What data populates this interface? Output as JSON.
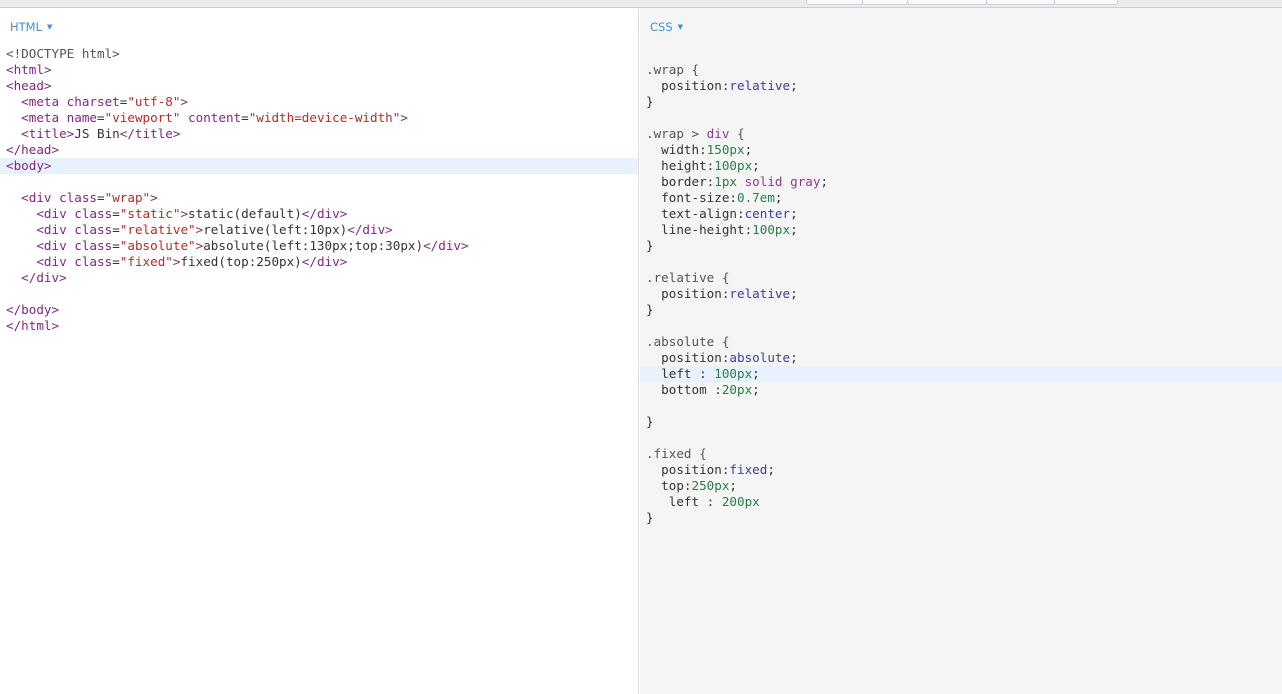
{
  "html_panel": {
    "label": "HTML",
    "lines": [
      [
        [
          "doc",
          "<!DOCTYPE html>"
        ]
      ],
      [
        [
          "tag",
          "<html>"
        ]
      ],
      [
        [
          "tag",
          "<head>"
        ]
      ],
      [
        [
          "txt",
          "  "
        ],
        [
          "tag",
          "<meta "
        ],
        [
          "attr",
          "charset"
        ],
        [
          "txt",
          "="
        ],
        [
          "str",
          "\"utf-8\""
        ],
        [
          "tag",
          ">"
        ]
      ],
      [
        [
          "txt",
          "  "
        ],
        [
          "tag",
          "<meta "
        ],
        [
          "attr",
          "name"
        ],
        [
          "txt",
          "="
        ],
        [
          "str",
          "\"viewport\""
        ],
        [
          "txt",
          " "
        ],
        [
          "attr",
          "content"
        ],
        [
          "txt",
          "="
        ],
        [
          "str",
          "\"width=device-width\""
        ],
        [
          "tag",
          ">"
        ]
      ],
      [
        [
          "txt",
          "  "
        ],
        [
          "tag",
          "<title>"
        ],
        [
          "txt",
          "JS Bin"
        ],
        [
          "tag",
          "</title>"
        ]
      ],
      [
        [
          "tag",
          "</head>"
        ]
      ],
      [
        [
          "tag",
          "<body>"
        ]
      ],
      [
        [
          "txt",
          ""
        ]
      ],
      [
        [
          "txt",
          "  "
        ],
        [
          "tag",
          "<div "
        ],
        [
          "attr",
          "class"
        ],
        [
          "txt",
          "="
        ],
        [
          "str",
          "\"wrap\""
        ],
        [
          "tag",
          ">"
        ]
      ],
      [
        [
          "txt",
          "    "
        ],
        [
          "tag",
          "<div "
        ],
        [
          "attr",
          "class"
        ],
        [
          "txt",
          "="
        ],
        [
          "str",
          "\"static\""
        ],
        [
          "tag",
          ">"
        ],
        [
          "txt",
          "static(default)"
        ],
        [
          "tag",
          "</div>"
        ]
      ],
      [
        [
          "txt",
          "    "
        ],
        [
          "tag",
          "<div "
        ],
        [
          "attr",
          "class"
        ],
        [
          "txt",
          "="
        ],
        [
          "str",
          "\"relative\""
        ],
        [
          "tag",
          ">"
        ],
        [
          "txt",
          "relative(left:10px)"
        ],
        [
          "tag",
          "</div>"
        ]
      ],
      [
        [
          "txt",
          "    "
        ],
        [
          "tag",
          "<div "
        ],
        [
          "attr",
          "class"
        ],
        [
          "txt",
          "="
        ],
        [
          "str",
          "\"absolute\""
        ],
        [
          "tag",
          ">"
        ],
        [
          "txt",
          "absolute(left:130px;top:30px)"
        ],
        [
          "tag",
          "</div>"
        ]
      ],
      [
        [
          "txt",
          "    "
        ],
        [
          "tag",
          "<div "
        ],
        [
          "attr",
          "class"
        ],
        [
          "txt",
          "="
        ],
        [
          "str",
          "\"fixed\""
        ],
        [
          "tag",
          ">"
        ],
        [
          "txt",
          "fixed(top:250px)"
        ],
        [
          "tag",
          "</div>"
        ]
      ],
      [
        [
          "txt",
          "  "
        ],
        [
          "tag",
          "</div>"
        ]
      ],
      [
        [
          "txt",
          ""
        ]
      ],
      [
        [
          "tag",
          "</body>"
        ]
      ],
      [
        [
          "tag",
          "</html>"
        ]
      ]
    ],
    "active_line": 7
  },
  "css_panel": {
    "label": "CSS",
    "lines": [
      [
        [
          "sel",
          ".wrap {"
        ]
      ],
      [
        [
          "prop",
          "  position:"
        ],
        [
          "val",
          "relative"
        ],
        [
          "pun",
          ";"
        ]
      ],
      [
        [
          "pun",
          "}"
        ]
      ],
      [
        [
          "txt",
          ""
        ]
      ],
      [
        [
          "sel",
          ".wrap > "
        ],
        [
          "kw",
          "div"
        ],
        [
          "sel",
          " {"
        ]
      ],
      [
        [
          "prop",
          "  width:"
        ],
        [
          "num",
          "150px"
        ],
        [
          "pun",
          ";"
        ]
      ],
      [
        [
          "prop",
          "  height:"
        ],
        [
          "num",
          "100px"
        ],
        [
          "pun",
          ";"
        ]
      ],
      [
        [
          "prop",
          "  border:"
        ],
        [
          "num",
          "1px"
        ],
        [
          "txt",
          " "
        ],
        [
          "kw",
          "solid"
        ],
        [
          "txt",
          " "
        ],
        [
          "kw",
          "gray"
        ],
        [
          "pun",
          ";"
        ]
      ],
      [
        [
          "prop",
          "  font-size:"
        ],
        [
          "num",
          "0.7em"
        ],
        [
          "pun",
          ";"
        ]
      ],
      [
        [
          "prop",
          "  text-align:"
        ],
        [
          "val",
          "center"
        ],
        [
          "pun",
          ";"
        ]
      ],
      [
        [
          "prop",
          "  line-height:"
        ],
        [
          "num",
          "100px"
        ],
        [
          "pun",
          ";"
        ]
      ],
      [
        [
          "pun",
          "}"
        ]
      ],
      [
        [
          "txt",
          ""
        ]
      ],
      [
        [
          "sel",
          ".relative {"
        ]
      ],
      [
        [
          "prop",
          "  position:"
        ],
        [
          "val",
          "relative"
        ],
        [
          "pun",
          ";"
        ]
      ],
      [
        [
          "pun",
          "}"
        ]
      ],
      [
        [
          "txt",
          ""
        ]
      ],
      [
        [
          "sel",
          ".absolute {"
        ]
      ],
      [
        [
          "prop",
          "  position:"
        ],
        [
          "val",
          "absolute"
        ],
        [
          "pun",
          ";"
        ]
      ],
      [
        [
          "prop",
          "  left : "
        ],
        [
          "num",
          "100px"
        ],
        [
          "pun",
          ";"
        ]
      ],
      [
        [
          "prop",
          "  bottom :"
        ],
        [
          "num",
          "20px"
        ],
        [
          "pun",
          ";"
        ]
      ],
      [
        [
          "txt",
          ""
        ]
      ],
      [
        [
          "pun",
          "}"
        ]
      ],
      [
        [
          "txt",
          ""
        ]
      ],
      [
        [
          "sel",
          ".fixed {"
        ]
      ],
      [
        [
          "prop",
          "  position:"
        ],
        [
          "val",
          "fixed"
        ],
        [
          "pun",
          ";"
        ]
      ],
      [
        [
          "prop",
          "  top:"
        ],
        [
          "num",
          "250px"
        ],
        [
          "pun",
          ";"
        ]
      ],
      [
        [
          "prop",
          "   left : "
        ],
        [
          "num",
          "200px"
        ]
      ],
      [
        [
          "pun",
          "}"
        ]
      ]
    ],
    "active_line": 19
  }
}
